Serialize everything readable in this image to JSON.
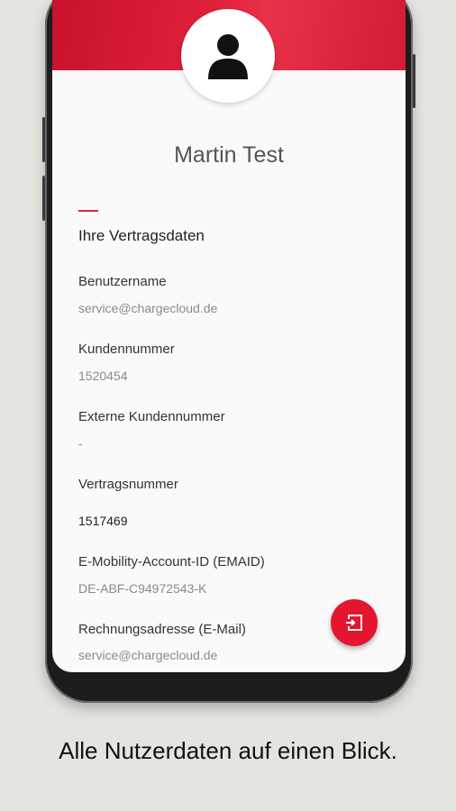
{
  "profile": {
    "name": "Martin Test"
  },
  "contract": {
    "section_title": "Ihre Vertragsdaten",
    "fields": [
      {
        "label": "Benutzername",
        "value": "service@chargecloud.de"
      },
      {
        "label": "Kundennummer",
        "value": "1520454"
      },
      {
        "label": "Externe Kundennummer",
        "value": "-"
      },
      {
        "label": "Vertragsnummer",
        "value": "1517469"
      },
      {
        "label": "E-Mobility-Account-ID (EMAID)",
        "value": "DE-ABF-C94972543-K"
      },
      {
        "label": "Rechnungsadresse (E-Mail)",
        "value": "service@chargecloud.de"
      }
    ]
  },
  "fab": {
    "icon": "logout-icon"
  },
  "avatar": {
    "icon": "person-icon"
  },
  "caption": "Alle Nutzerdaten auf einen Blick.",
  "colors": {
    "accent": "#e4162f",
    "background": "#e4e5df"
  }
}
